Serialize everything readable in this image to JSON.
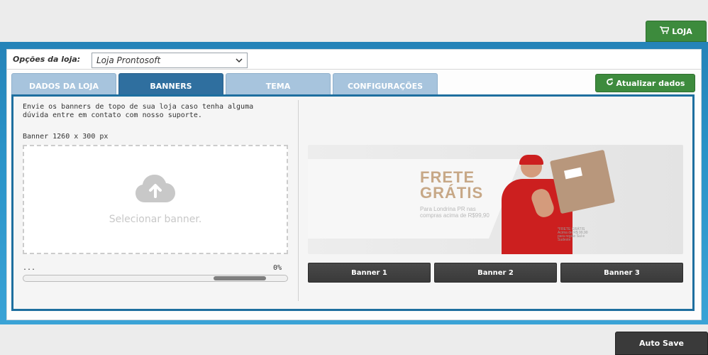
{
  "header": {
    "store_button_label": "LOJA"
  },
  "store_options": {
    "label": "Opções da loja:",
    "selected": "Loja Prontosoft"
  },
  "tabs": [
    {
      "label": "DADOS DA LOJA",
      "active": false
    },
    {
      "label": "BANNERS",
      "active": true
    },
    {
      "label": "TEMA",
      "active": false
    },
    {
      "label": "CONFIGURAÇÕES",
      "active": false
    }
  ],
  "refresh_button_label": "Atualizar dados",
  "banners": {
    "intro_text": "Envie os banners de topo de sua loja caso tenha alguma dúvida entre em contato com nosso suporte.",
    "size_label": "Banner 1260 x 300 px",
    "dropzone_text": "Selecionar banner.",
    "progress_status": "...",
    "progress_percent_label": "0%",
    "preview": {
      "title_line1": "FRETE",
      "title_line2": "GRÁTIS",
      "subtitle": "Para Londrina PR nas compras acima de R$99,90",
      "fine_print": "*FRETE GRÁTIS Acima de R$ 99,90 para região Sul e Sudeste"
    },
    "thumb_buttons": [
      "Banner 1",
      "Banner 2",
      "Banner 3"
    ]
  },
  "footer": {
    "autosave_label": "Auto Save"
  },
  "colors": {
    "green_button": "#3d8b3d",
    "active_tab": "#2f6f9f",
    "inactive_tab": "#a7c4dd",
    "frame_blue": "#2a93c8"
  }
}
